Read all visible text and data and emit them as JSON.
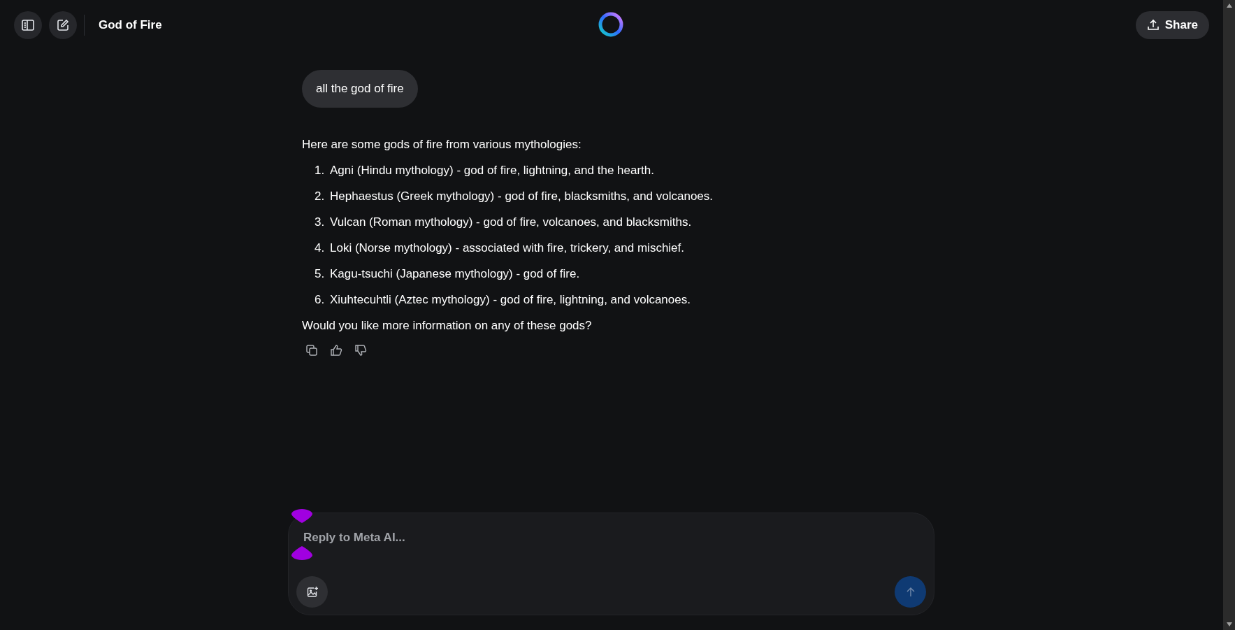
{
  "header": {
    "title": "God of Fire",
    "share_label": "Share"
  },
  "user_message": "all the god of fire",
  "reply": {
    "intro": "Here are some gods of fire from various mythologies:",
    "items": [
      {
        "number": "1.",
        "text": "Agni (Hindu mythology) - god of fire, lightning, and the hearth."
      },
      {
        "number": "2.",
        "text": "Hephaestus (Greek mythology) - god of fire, blacksmiths, and volcanoes."
      },
      {
        "number": "3.",
        "text": "Vulcan (Roman mythology) - god of fire, volcanoes, and blacksmiths."
      },
      {
        "number": "4.",
        "text": "Loki (Norse mythology) - associated with fire, trickery, and mischief."
      },
      {
        "number": "5.",
        "text": "Kagu-tsuchi (Japanese mythology) - god of fire."
      },
      {
        "number": "6.",
        "text": "Xiuhtecuhtli (Aztec mythology) - god of fire, lightning, and volcanoes."
      }
    ],
    "closing": "Would you like more information on any of these gods?"
  },
  "composer": {
    "placeholder": "Reply to Meta AI...",
    "send_disabled": true
  }
}
